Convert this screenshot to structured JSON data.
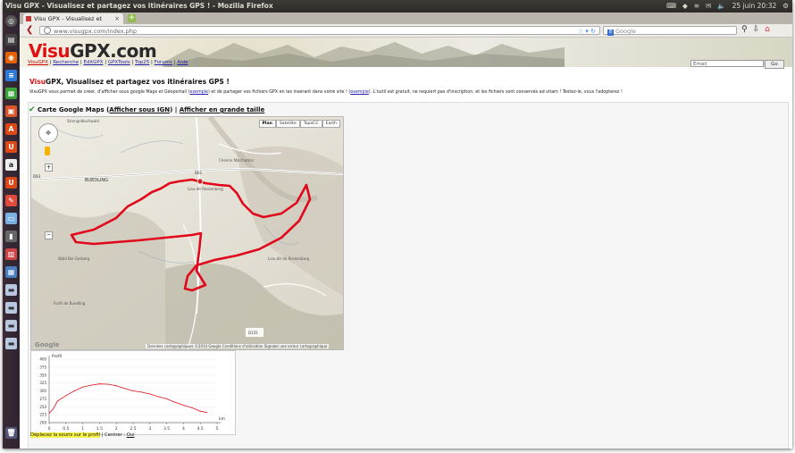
{
  "system": {
    "window_title": "Visu GPX - Visualisez et partagez vos itinéraires GPS ! - Mozilla Firefox",
    "datetime": "25 juin 20:32"
  },
  "browser": {
    "tab_title": "Visu GPX - Visualisez et partag...",
    "url": "www.visugpx.com/index.php",
    "search_placeholder": "Google"
  },
  "site": {
    "logo_visu": "Visu",
    "logo_gpx": "GPX.com",
    "nav": [
      "VisuGPX",
      "Recherche",
      "EditGPX",
      "GPXTools",
      "Top25",
      "Forums",
      "Aide"
    ],
    "email_placeholder": "Email",
    "go_label": "Go",
    "headline_red": "Visu",
    "headline_rest": "GPX, Visualisez et partagez vos itinéraires GPS !",
    "intro_a": "VisuGPX vous permet de créer, d'afficher sous google Maps et Géoportail (",
    "intro_link1": "exemple",
    "intro_b": ") et de partager vos fichiers GPX en les insérant dans votre site ! (",
    "intro_link2": "exemple",
    "intro_c": "). L'outil est gratuit, ne requiert pas d'inscription, et les fichiers sont conservés ad vitam ! Testez-le, vous l'adopterez !"
  },
  "map": {
    "title_prefix": "Carte Google Maps (",
    "link_ign": "Afficher sous IGN",
    "separator": ") | ",
    "link_large": "Afficher en grande taille",
    "types": [
      "Plan",
      "Satellite",
      "TopoCC",
      "Earth"
    ],
    "labels": [
      "Strengelbachwald",
      "BUEDLING",
      "Lieu-dit Reckenberg",
      "Wald Bei Gesberg",
      "Forêt de Buedling",
      "Lieu-dit du Reckenberg",
      "Chemin Marchettes",
      "D61",
      "D63",
      "D155"
    ],
    "copyright": "Données cartographiques ©2014 Google   Conditions d'utilisation   Signaler une erreur cartographique",
    "google": "Google"
  },
  "profile": {
    "title": "Profil",
    "unit": "km",
    "y_ticks": [
      "400",
      "375",
      "350",
      "325",
      "300",
      "275",
      "250",
      "225",
      "200"
    ],
    "x_ticks": [
      "0",
      "0.5",
      "1",
      "1.5",
      "2",
      "2.5",
      "3",
      "3.5",
      "4",
      "4.5",
      "5"
    ],
    "highlight": "Déplacez la souris sur le profil",
    "center_label": "| Centrer : ",
    "center_value": "Oui"
  },
  "chart_data": {
    "type": "line",
    "title": "Profil",
    "xlabel": "km",
    "ylabel": "",
    "xlim": [
      0,
      5
    ],
    "ylim": [
      200,
      400
    ],
    "x": [
      0,
      0.1,
      0.25,
      0.5,
      0.75,
      1,
      1.25,
      1.5,
      1.75,
      2,
      2.25,
      2.5,
      2.75,
      3,
      3.25,
      3.5,
      3.75,
      4,
      4.25,
      4.5,
      4.7
    ],
    "series": [
      {
        "values": [
          230,
          240,
          268,
          285,
          300,
          312,
          318,
          322,
          321,
          316,
          308,
          300,
          296,
          290,
          282,
          275,
          264,
          255,
          247,
          236,
          232
        ]
      }
    ]
  },
  "colors": {
    "accent_red": "#e01010",
    "route_red": "#e0081a",
    "profile_line": "#e0101a"
  }
}
